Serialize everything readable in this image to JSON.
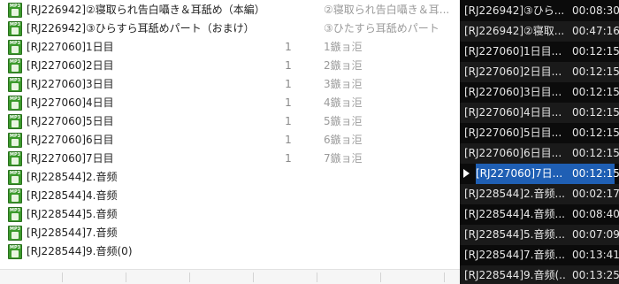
{
  "file_list": {
    "items": [
      {
        "name": "[RJ226942]②寝取られ告白囁き＆耳舐め（本編）",
        "track": "",
        "extra": "②寝取られ告白囁き＆耳...",
        "icon": "mp3-file-icon"
      },
      {
        "name": "[RJ226942]③ひらすら耳舐めパート（おまけ）",
        "track": "",
        "extra": "③ひたすら耳舐めパート",
        "icon": "mp3-file-icon"
      },
      {
        "name": "[RJ227060]1日目",
        "track": "1",
        "extra": "1鏃ョ洰",
        "icon": "mp3-file-icon"
      },
      {
        "name": "[RJ227060]2日目",
        "track": "1",
        "extra": "2鏃ョ洰",
        "icon": "mp3-file-icon"
      },
      {
        "name": "[RJ227060]3日目",
        "track": "1",
        "extra": "3鏃ョ洰",
        "icon": "mp3-file-icon"
      },
      {
        "name": "[RJ227060]4日目",
        "track": "1",
        "extra": "4鏃ョ洰",
        "icon": "mp3-file-icon"
      },
      {
        "name": "[RJ227060]5日目",
        "track": "1",
        "extra": "5鏃ョ洰",
        "icon": "mp3-file-icon"
      },
      {
        "name": "[RJ227060]6日目",
        "track": "1",
        "extra": "6鏃ョ洰",
        "icon": "mp3-file-icon"
      },
      {
        "name": "[RJ227060]7日目",
        "track": "1",
        "extra": "7鏃ョ洰",
        "icon": "mp3-file-icon"
      },
      {
        "name": "[RJ228544]2.音频",
        "track": "",
        "extra": "",
        "icon": "mp3-file-icon"
      },
      {
        "name": "[RJ228544]4.音频",
        "track": "",
        "extra": "",
        "icon": "mp3-file-icon"
      },
      {
        "name": "[RJ228544]5.音频",
        "track": "",
        "extra": "",
        "icon": "mp3-file-icon"
      },
      {
        "name": "[RJ228544]7.音频",
        "track": "",
        "extra": "",
        "icon": "mp3-file-icon"
      },
      {
        "name": "[RJ228544]9.音频(0)",
        "track": "",
        "extra": "",
        "icon": "mp3-file-icon"
      }
    ],
    "icon_label": "MP3"
  },
  "playlist": {
    "items": [
      {
        "title": "[RJ226942]③ひら...",
        "time": "00:08:30",
        "current": false
      },
      {
        "title": "[RJ226942]②寝取...",
        "time": "00:47:16",
        "current": false
      },
      {
        "title": "[RJ227060]1日目...",
        "time": "00:12:15",
        "current": false
      },
      {
        "title": "[RJ227060]2日目...",
        "time": "00:12:15",
        "current": false
      },
      {
        "title": "[RJ227060]3日目...",
        "time": "00:12:15",
        "current": false
      },
      {
        "title": "[RJ227060]4日目...",
        "time": "00:12:15",
        "current": false
      },
      {
        "title": "[RJ227060]5日目...",
        "time": "00:12:15",
        "current": false
      },
      {
        "title": "[RJ227060]6日目...",
        "time": "00:12:15",
        "current": false
      },
      {
        "title": "[RJ227060]7日...",
        "time": "00:12:15",
        "current": true
      },
      {
        "title": "[RJ228544]2.音频...",
        "time": "00:02:17",
        "current": false
      },
      {
        "title": "[RJ228544]4.音频...",
        "time": "00:08:40",
        "current": false
      },
      {
        "title": "[RJ228544]5.音频...",
        "time": "00:07:09",
        "current": false
      },
      {
        "title": "[RJ228544]7.音频...",
        "time": "00:13:41",
        "current": false
      },
      {
        "title": "[RJ228544]9.音频(...",
        "time": "00:13:25",
        "current": false
      }
    ],
    "current_indicator_icon": "play-arrow-icon",
    "colors": {
      "background": "#0b0b0b",
      "alt_row": "#1a1a1a",
      "highlight": "#1f5fb4",
      "text": "#e6e6e6"
    }
  }
}
